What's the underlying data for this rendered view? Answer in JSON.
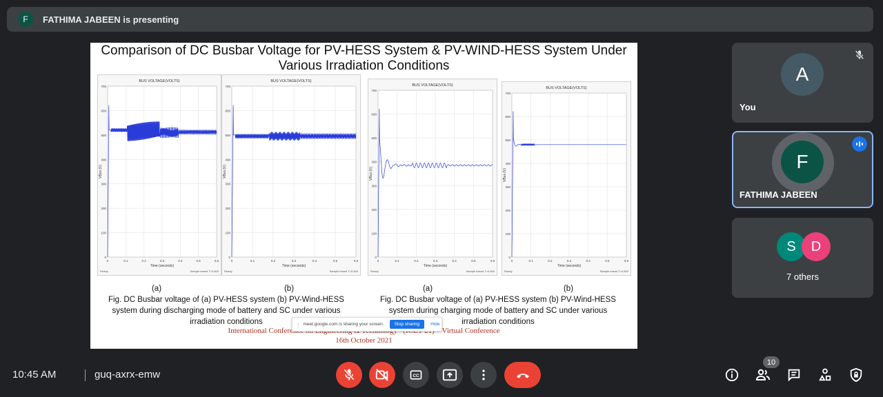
{
  "presenting": {
    "avatar_letter": "F",
    "text": "FATHIMA JABEEN is presenting"
  },
  "slide": {
    "title_line1": "Comparison of DC Busbar Voltage for PV-HESS System & PV-WIND-HESS System Under",
    "title_line2": "Various Irradiation Conditions",
    "plots": [
      {
        "title": "BUS VOLTAGE(VOLTS)",
        "ylabel": "VBus (V)",
        "xlabel": "Time (seconds)",
        "yticks": [
          "700",
          "600",
          "500",
          "400",
          "300",
          "200",
          "100",
          "0"
        ],
        "xticks": [
          "0",
          "0.1",
          "0.2",
          "0.3",
          "0.4",
          "0.5",
          "0.6"
        ],
        "status_left": "Ready",
        "status_right": "Sample based  T=0.600"
      },
      {
        "title": "BUS VOLTAGE(VOLTS)",
        "ylabel": "VBus (V)",
        "xlabel": "Time (seconds)",
        "yticks": [
          "700",
          "600",
          "500",
          "400",
          "300",
          "200",
          "100",
          "0"
        ],
        "xticks": [
          "0",
          "0.1",
          "0.2",
          "0.3",
          "0.4",
          "0.5",
          "0.6"
        ],
        "status_left": "Ready",
        "status_right": "Sample based  T=0.600"
      },
      {
        "title": "BUS VOLTAGE(VOLTS)",
        "ylabel": "VBus (V)",
        "xlabel": "Time (seconds)",
        "yticks": [
          "700",
          "600",
          "500",
          "400",
          "300",
          "200",
          "100",
          "0"
        ],
        "xticks": [
          "0",
          "0.1",
          "0.2",
          "0.3",
          "0.4",
          "0.5",
          "0.6"
        ],
        "status_left": "Ready",
        "status_right": "Sample based  T=0.600"
      },
      {
        "title": "BUS VOLTAGE(VOLTS)",
        "ylabel": "VBus (V)",
        "xlabel": "Time (seconds)",
        "yticks": [
          "700",
          "600",
          "500",
          "400",
          "300",
          "200",
          "100",
          "0"
        ],
        "xticks": [
          "0",
          "0.1",
          "0.2",
          "0.3",
          "0.4",
          "0.5",
          "0.6"
        ],
        "status_left": "Ready",
        "status_right": "Sample based  T=0.600"
      }
    ],
    "labels": [
      "(a)",
      "(b)",
      "(a)",
      "(b)"
    ],
    "caption_left": "Fig. DC Busbar voltage of (a) PV-HESS system (b) PV-Wind-HESS system during discharging mode of battery and SC under various irradiation conditions",
    "caption_right": "Fig. DC Busbar voltage of (a) PV-HESS system (b) PV-Wind-HESS system during charging mode of battery and SC under various irradiation conditions",
    "conference_line1": "International Conference on Engineering & Technology –(ICET-21) – Virtual Conference",
    "conference_line2": "16th October 2021",
    "share_banner": {
      "text": "meet.google.com is sharing your screen.",
      "stop": "Stop sharing",
      "hide": "Hide"
    }
  },
  "participants": [
    {
      "letter": "A",
      "name": "You",
      "color": "#455a64",
      "muted": true
    },
    {
      "letter": "F",
      "name": "FATHIMA JABEEN",
      "color": "#0b5345",
      "speaking": true
    },
    {
      "letters": [
        "S",
        "D"
      ],
      "colors": [
        "#00897b",
        "#ec407a"
      ],
      "name": "7 others"
    }
  ],
  "bottom": {
    "time": "10:45 AM",
    "meeting_code": "guq-axrx-emw",
    "people_count": "10",
    "accent_red": "#ea4335"
  }
}
